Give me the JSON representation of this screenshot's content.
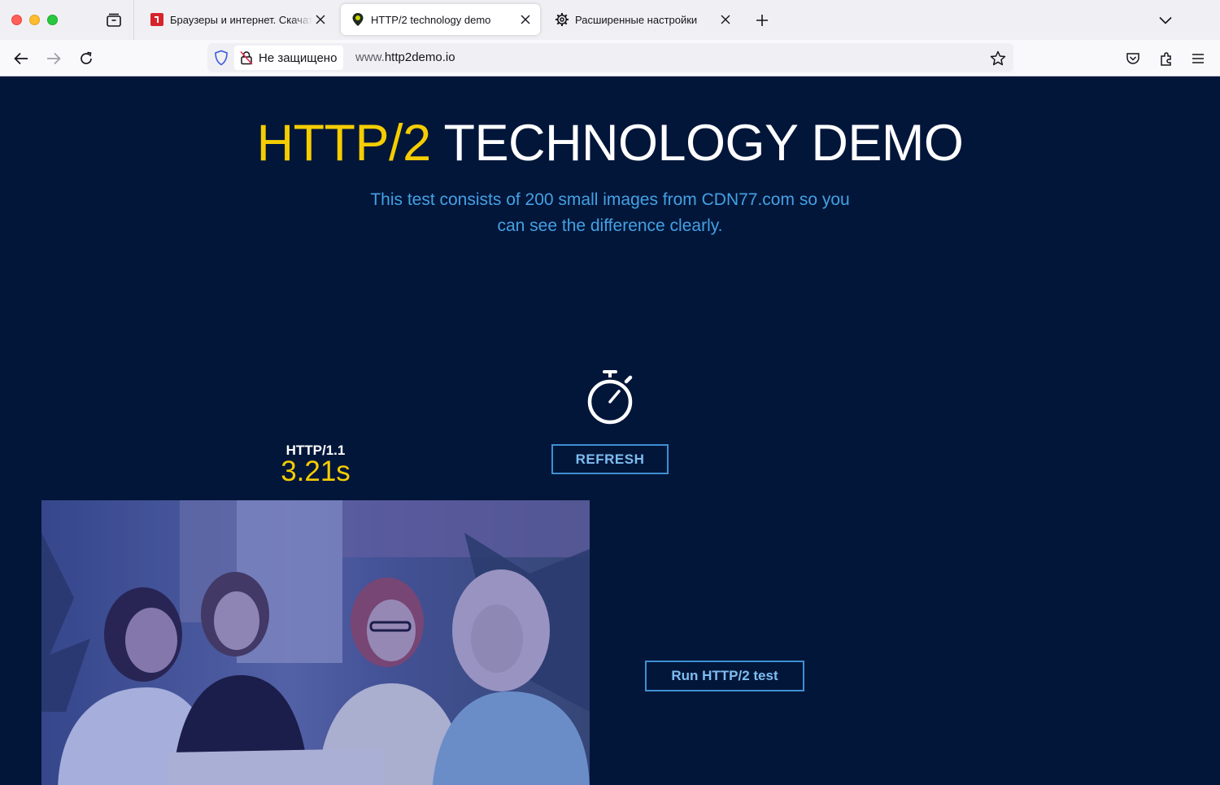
{
  "browser": {
    "tabs": [
      {
        "title": "Браузеры и интернет. Скачать",
        "favicon": "red-site-icon",
        "active": false
      },
      {
        "title": "HTTP/2 technology demo",
        "favicon": "location-pin-icon",
        "active": true
      },
      {
        "title": "Расширенные настройки",
        "favicon": "gear-icon",
        "active": false
      }
    ],
    "urlbar": {
      "security_label": "Не защищено",
      "url_prefix": "www.",
      "url_domain": "http2demo.io"
    }
  },
  "page": {
    "headline_accent": "HTTP/2",
    "headline_rest": " TECHNOLOGY DEMO",
    "intro_line1": "This test consists of 200 small images from CDN77.com so you",
    "intro_line2": "can see the difference clearly.",
    "refresh_label": "REFRESH",
    "protocol_label": "HTTP/1.1",
    "protocol_time": "3.21s",
    "run_label": "Run HTTP/2 test"
  },
  "colors": {
    "page_bg": "#02163a",
    "accent_yellow": "#f5cd00",
    "link_blue": "#44a1e3",
    "button_border": "#3f8fd2"
  }
}
